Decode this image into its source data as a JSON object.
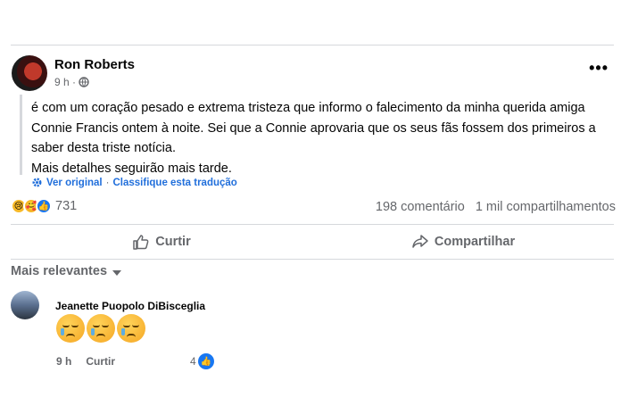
{
  "post": {
    "author": "Ron Roberts",
    "time": "9 h ·",
    "more_label": "•••",
    "text_lines": [
      "é com um coração pesado e extrema tristeza que informo o falecimento da minha querida amiga",
      "Connie Francis ontem à noite. Sei que a Connie aprovaria que os seus fãs fossem dos primeiros a",
      "saber desta triste notícia.",
      "Mais detalhes seguirão mais tarde."
    ],
    "see_original": "Ver original",
    "separator": "·",
    "rate_translation": "Classifique esta tradução"
  },
  "stats": {
    "reaction_count": "731",
    "comments": "198 comentário",
    "shares": "1 mil compartilhamentos"
  },
  "actions": {
    "like": "Curtir",
    "share": "Compartilhar"
  },
  "sort_label": "Mais relevantes",
  "comment": {
    "author": "Jeanette Puopolo DiBisceglia",
    "time": "9 h",
    "like_label": "Curtir",
    "reaction_count": "4"
  }
}
